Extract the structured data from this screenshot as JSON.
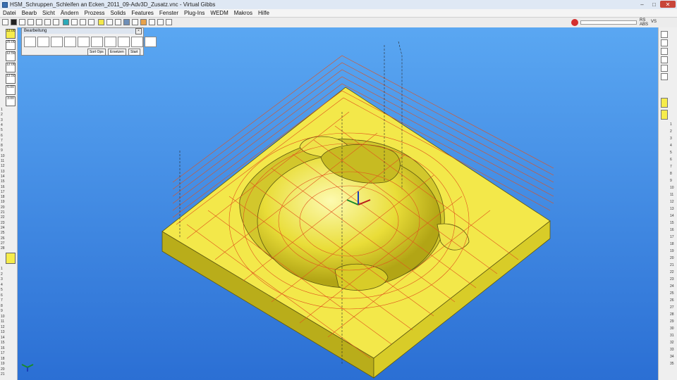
{
  "window": {
    "title": "HSM_Schruppen_Schleifen an Ecken_2011_09-Adv3D_Zusatz.vnc - Virtual Gibbs",
    "buttons": [
      "–",
      "□",
      "✕"
    ]
  },
  "menu": [
    "Datei",
    "Bearb",
    "Sicht",
    "Ändern",
    "Prozess",
    "Solids",
    "Features",
    "Fenster",
    "Plug-Ins",
    "WEDM",
    "Makros",
    "Hilfe"
  ],
  "status": {
    "rs_top": "RS",
    "rs_bottom": "ABS",
    "vs": "VS"
  },
  "left_tools": [
    "12.00",
    "25.00",
    "12.50",
    "12.00",
    "12.50",
    "6.00",
    "3.00"
  ],
  "left_numbers_top": [
    "1",
    "2",
    "3",
    "4",
    "5",
    "6",
    "7",
    "8",
    "9",
    "10",
    "11",
    "12",
    "13",
    "14",
    "15",
    "16",
    "17",
    "18",
    "19",
    "20",
    "21",
    "22",
    "23",
    "24",
    "25",
    "26",
    "27",
    "28"
  ],
  "left_numbers_bottom": [
    "1",
    "2",
    "3",
    "4",
    "5",
    "6",
    "7",
    "8",
    "9",
    "10",
    "11",
    "12",
    "13",
    "14",
    "15",
    "16",
    "17",
    "18",
    "19",
    "20",
    "21"
  ],
  "right_numbers": [
    "1",
    "2",
    "3",
    "4",
    "5",
    "6",
    "7",
    "8",
    "9",
    "10",
    "11",
    "12",
    "13",
    "14",
    "15",
    "16",
    "17",
    "18",
    "19",
    "20",
    "21",
    "22",
    "23",
    "24",
    "25",
    "26",
    "27",
    "28",
    "29",
    "30",
    "31",
    "32",
    "33",
    "34",
    "35"
  ],
  "panel": {
    "title": "Bearbeitung",
    "buttons": [
      "Sort Ops",
      "Ersetzen",
      "Start"
    ]
  },
  "colors": {
    "viewport_top": "#5aa7f2",
    "viewport_bottom": "#2b6fd4",
    "part": "#f3e84a",
    "toolpath": "#e0521e"
  }
}
